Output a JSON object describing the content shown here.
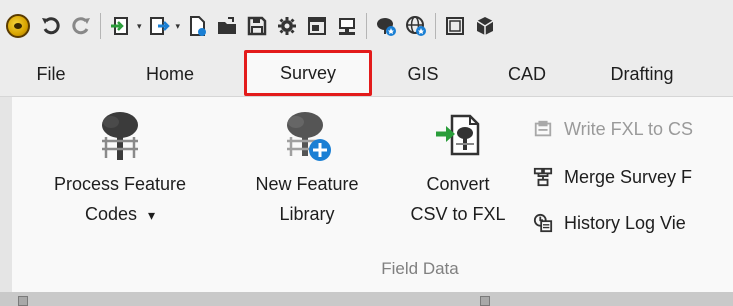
{
  "quick_access": {
    "icons": [
      "app-logo-icon",
      "undo-icon",
      "redo-icon",
      "import-icon",
      "export-icon",
      "new-file-icon",
      "open-folder-icon",
      "save-icon",
      "settings-gear-icon",
      "window-icon",
      "monitor-icon",
      "tree-star-icon",
      "globe-star-icon",
      "frame-icon",
      "cube-icon"
    ],
    "dropdown_glyph": "▾"
  },
  "tabs": [
    {
      "label": "File"
    },
    {
      "label": "Home"
    },
    {
      "label": "Survey"
    },
    {
      "label": "GIS"
    },
    {
      "label": "CAD"
    },
    {
      "label": "Drafting"
    }
  ],
  "active_tab": "Survey",
  "ribbon": {
    "group_label": "Field Data",
    "process_feature_codes": {
      "line1": "Process Feature",
      "line2": "Codes",
      "caret": "▾",
      "icon": "tree-fence-icon"
    },
    "new_feature_library": {
      "line1": "New Feature",
      "line2": "Library",
      "icon": "tree-add-icon"
    },
    "convert_csv": {
      "line1": "Convert",
      "line2": "CSV to FXL",
      "icon": "convert-file-icon"
    },
    "small_buttons": [
      {
        "label": "Write FXL to CS",
        "disabled": true,
        "icon": "write-fxl-icon"
      },
      {
        "label": "Merge Survey F",
        "disabled": false,
        "icon": "merge-icon"
      },
      {
        "label": "History Log Vie",
        "disabled": false,
        "icon": "history-log-icon"
      }
    ]
  },
  "colors": {
    "active_tab_outline": "#e31b1b",
    "ribbon_bg": "#f9f9f9",
    "toolbar_bg": "#ececec",
    "group_label": "#808080",
    "disabled_text": "#9a9a9a",
    "accent_blue": "#1a7fd4"
  }
}
